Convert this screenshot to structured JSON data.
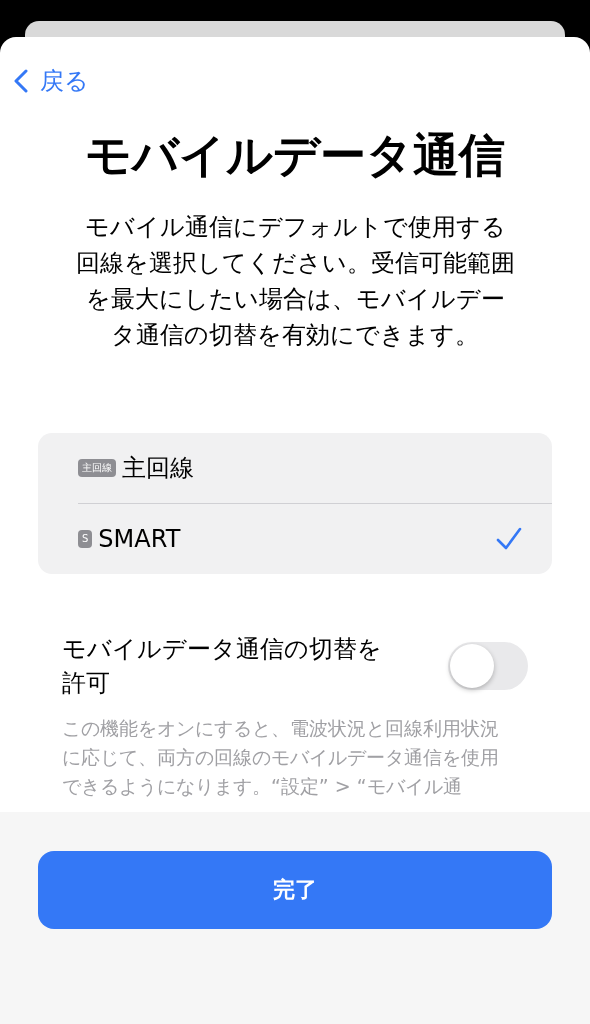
{
  "nav": {
    "back": "戻る"
  },
  "title": "モバイルデータ通信",
  "description": "モバイル通信にデフォルトで使用する回線を選択してください。受信可能範囲を最大にしたい場合は、モバイルデータ通信の切替を有効にできます。",
  "lines": [
    {
      "badge": "主回線",
      "name": "主回線",
      "selected": false
    },
    {
      "badge": "S",
      "name": "SMART",
      "selected": true
    }
  ],
  "switching": {
    "label": "モバイルデータ通信の切替を許可",
    "on": false,
    "note": "この機能をオンにすると、電波状況と回線利用状況に応じて、両方の回線のモバイルデータ通信を使用できるようになります。“設定” > “モバイル通"
  },
  "done_button": "完了"
}
